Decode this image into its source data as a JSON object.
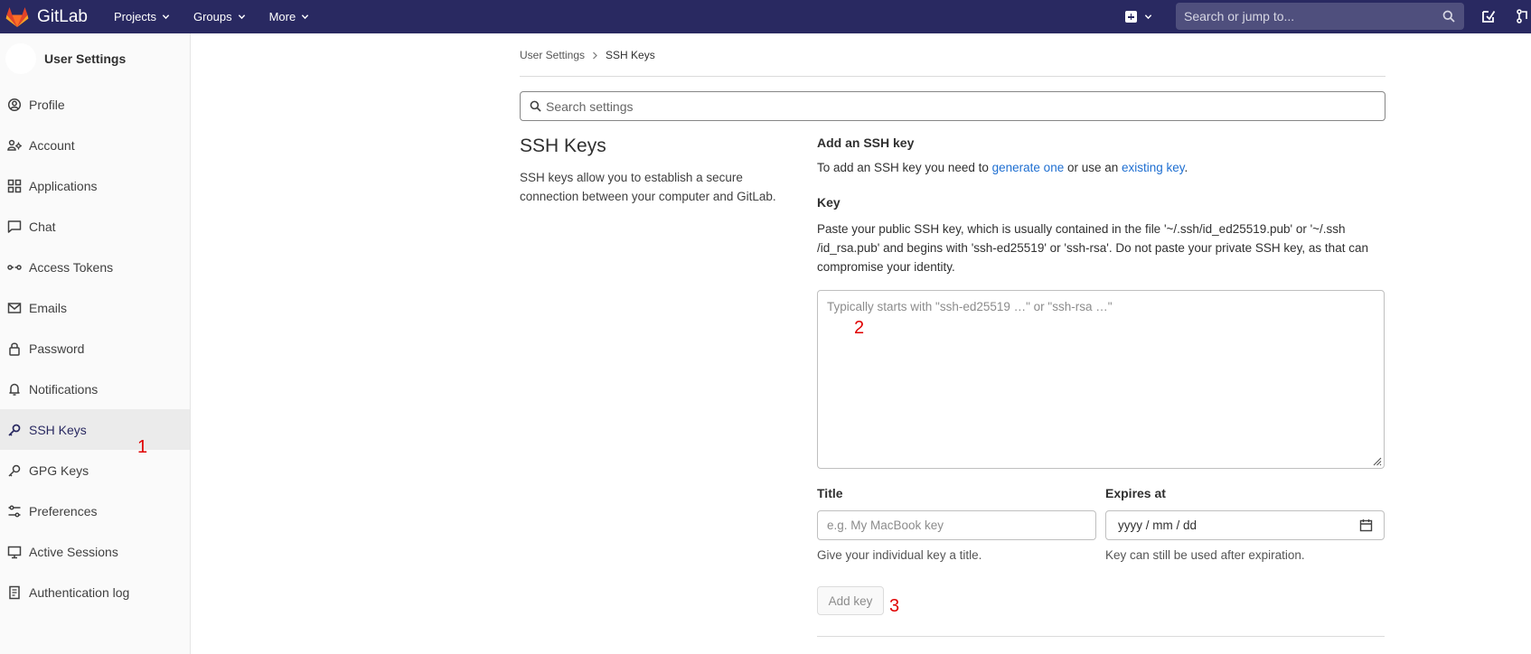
{
  "topbar": {
    "brand": "GitLab",
    "menu": [
      "Projects",
      "Groups",
      "More"
    ],
    "search_placeholder": "Search or jump to..."
  },
  "sidebar": {
    "title": "User Settings",
    "items": [
      {
        "label": "Profile",
        "icon": "profile-icon"
      },
      {
        "label": "Account",
        "icon": "account-icon"
      },
      {
        "label": "Applications",
        "icon": "applications-icon"
      },
      {
        "label": "Chat",
        "icon": "chat-icon"
      },
      {
        "label": "Access Tokens",
        "icon": "token-icon"
      },
      {
        "label": "Emails",
        "icon": "envelope-icon"
      },
      {
        "label": "Password",
        "icon": "lock-icon"
      },
      {
        "label": "Notifications",
        "icon": "bell-icon"
      },
      {
        "label": "SSH Keys",
        "icon": "key-icon",
        "active": true
      },
      {
        "label": "GPG Keys",
        "icon": "key-icon"
      },
      {
        "label": "Preferences",
        "icon": "preferences-icon"
      },
      {
        "label": "Active Sessions",
        "icon": "monitor-icon"
      },
      {
        "label": "Authentication log",
        "icon": "log-icon"
      }
    ]
  },
  "breadcrumb": {
    "parent": "User Settings",
    "current": "SSH Keys"
  },
  "settings_search": {
    "placeholder": "Search settings"
  },
  "section": {
    "title": "SSH Keys",
    "description": "SSH keys allow you to establish a secure connection between your computer and GitLab."
  },
  "add_key": {
    "heading": "Add an SSH key",
    "text_prefix": "To add an SSH key you need to ",
    "link_generate": "generate one",
    "text_middle": " or use an ",
    "link_existing": "existing key",
    "text_suffix": "."
  },
  "key": {
    "label": "Key",
    "help": "Paste your public SSH key, which is usually contained in the file '~/.ssh/id_ed25519.pub' or '~/.ssh /id_rsa.pub' and begins with 'ssh-ed25519' or 'ssh-rsa'. Do not paste your private SSH key, as that can compromise your identity.",
    "placeholder": "Typically starts with \"ssh-ed25519 …\" or \"ssh-rsa …\""
  },
  "title_field": {
    "label": "Title",
    "placeholder": "e.g. My MacBook key",
    "help": "Give your individual key a title."
  },
  "expires_field": {
    "label": "Expires at",
    "placeholder": "yyyy / mm / dd",
    "help": "Key can still be used after expiration."
  },
  "submit": {
    "label": "Add key"
  },
  "markers": {
    "m1": "1",
    "m2": "2",
    "m3": "3"
  },
  "colors": {
    "navbar": "#292961",
    "link": "#1f6fd1",
    "marker": "#e00000"
  }
}
